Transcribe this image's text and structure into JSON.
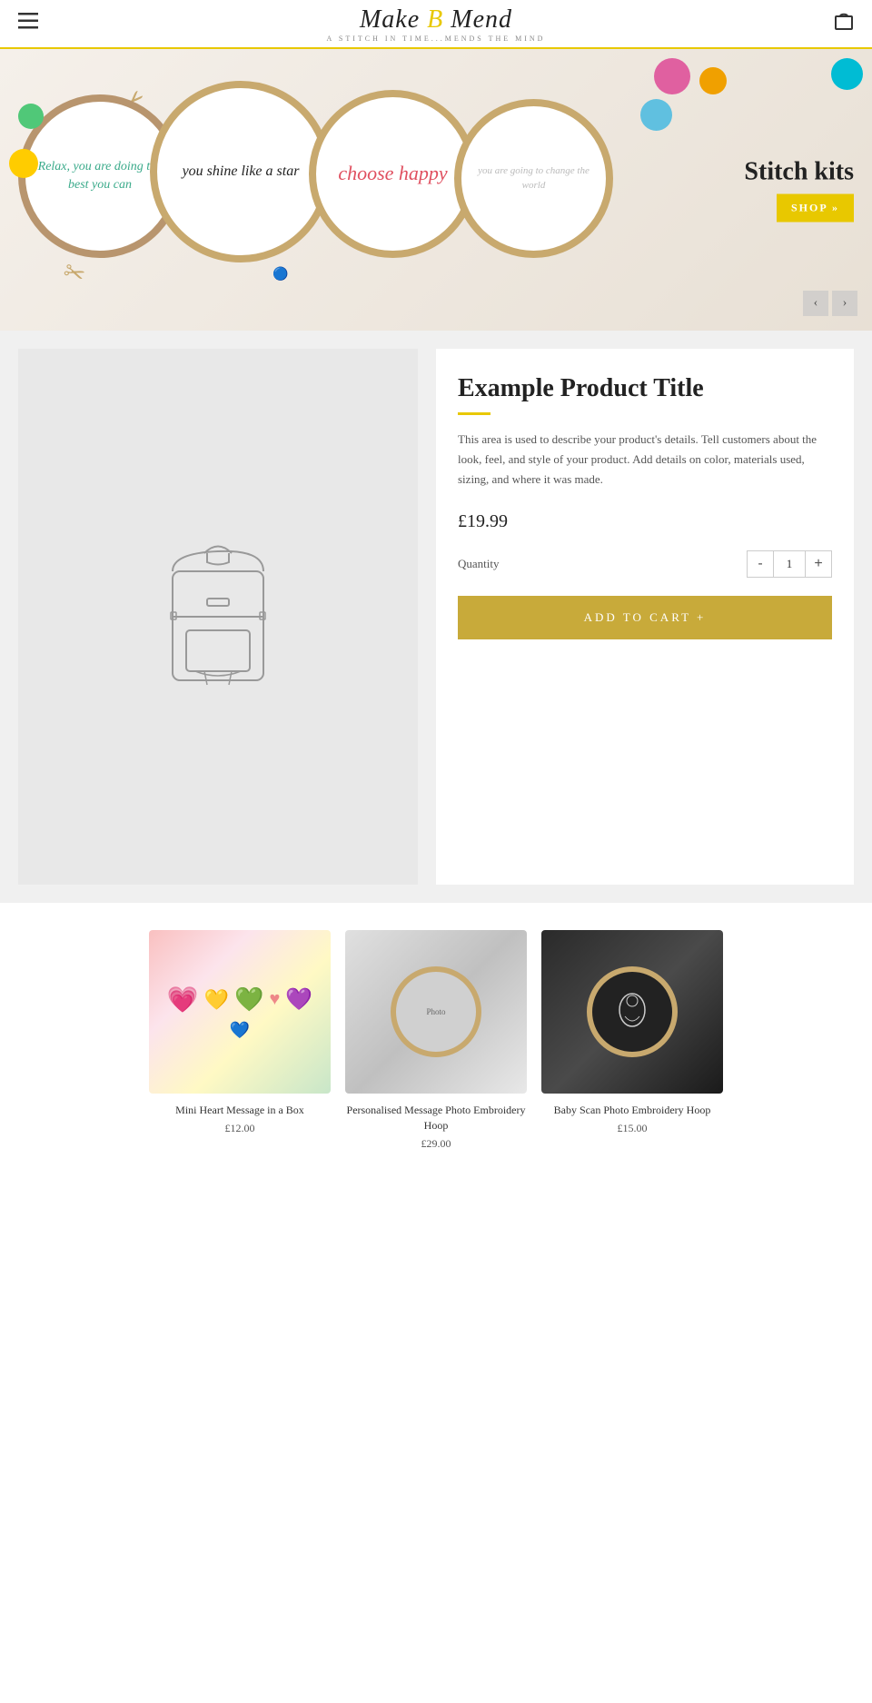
{
  "header": {
    "logo_main": "Make & Mend",
    "logo_sub": "A STITCH IN TIME...MENDS THE MIND",
    "menu_icon": "☰",
    "cart_icon": "🛍"
  },
  "hero": {
    "hoop1_text": "Relax, you are doing the best you can",
    "hoop2_text": "you shine like a star",
    "hoop3_text": "choose happy",
    "hoop4_text": "you are going to change the world",
    "cta_label": "Stitch kits",
    "shop_label": "SHOP »",
    "prev_icon": "‹",
    "next_icon": "›"
  },
  "product": {
    "title": "Example Product Title",
    "description": "This area is used to describe your product's details. Tell customers about the look, feel, and style of your product. Add details on color, materials used, sizing, and where it was made.",
    "price": "£19.99",
    "quantity_label": "Quantity",
    "qty_minus": "-",
    "qty_value": "1",
    "qty_plus": "+",
    "add_to_cart": "ADD TO CART +"
  },
  "related": {
    "products": [
      {
        "title": "Mini Heart Message in a Box",
        "price": "£12.00"
      },
      {
        "title": "Personalised Message Photo Embroidery Hoop",
        "price": "£29.00"
      },
      {
        "title": "Baby Scan Photo Embroidery Hoop",
        "price": "£15.00"
      }
    ]
  }
}
